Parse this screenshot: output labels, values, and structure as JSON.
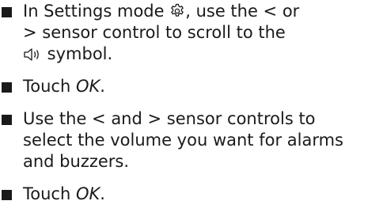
{
  "steps": [
    {
      "lines": [
        [
          "In Settings mode ",
          {
            "icon": "gear-icon"
          },
          ", use the < or"
        ],
        [
          "> sensor control to scroll to the"
        ],
        [
          {
            "icon": "speaker-icon"
          },
          " symbol."
        ]
      ]
    },
    {
      "lines": [
        [
          "Touch ",
          {
            "em": "OK"
          },
          "."
        ]
      ]
    },
    {
      "lines": [
        [
          "Use the < and > sensor controls to"
        ],
        [
          "select the volume you want for alarms"
        ],
        [
          "and buzzers."
        ]
      ]
    },
    {
      "lines": [
        [
          "Touch ",
          {
            "em": "OK"
          },
          "."
        ]
      ]
    }
  ]
}
